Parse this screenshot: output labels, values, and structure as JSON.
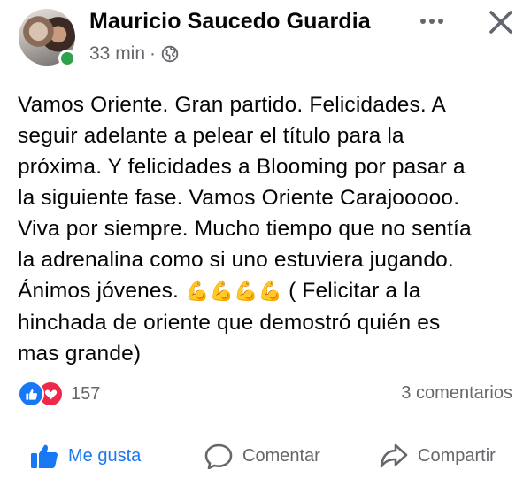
{
  "post": {
    "author": "Mauricio Saucedo Guardia",
    "time": "33 min",
    "separator": "·",
    "privacy_icon": "globe-icon",
    "text_before_emoji": "Vamos Oriente. Gran partido. Felicidades. A\nseguir adelante a pelear el título para la\npróxima. Y felicidades a Blooming por pasar a\nla siguiente fase. Vamos Oriente Carajooooo.\nViva por siempre. Mucho tiempo que no sentía\nla adrenalina como si uno estuviera jugando.\nÁnimos jóvenes. ",
    "emoji": "💪💪💪💪",
    "text_after_emoji": " ( Felicitar a la\nhinchada de oriente que demostró quién es\nmas grande)"
  },
  "header_icons": {
    "more": "more-icon",
    "close": "close-icon"
  },
  "stats": {
    "reaction_count": "157",
    "comments": "3 comentarios"
  },
  "actions": {
    "like": "Me gusta",
    "comment": "Comentar",
    "share": "Compartir"
  },
  "colors": {
    "accent": "#1877f2",
    "love": "#f02849",
    "online": "#31a24c",
    "muted": "#65676b"
  }
}
